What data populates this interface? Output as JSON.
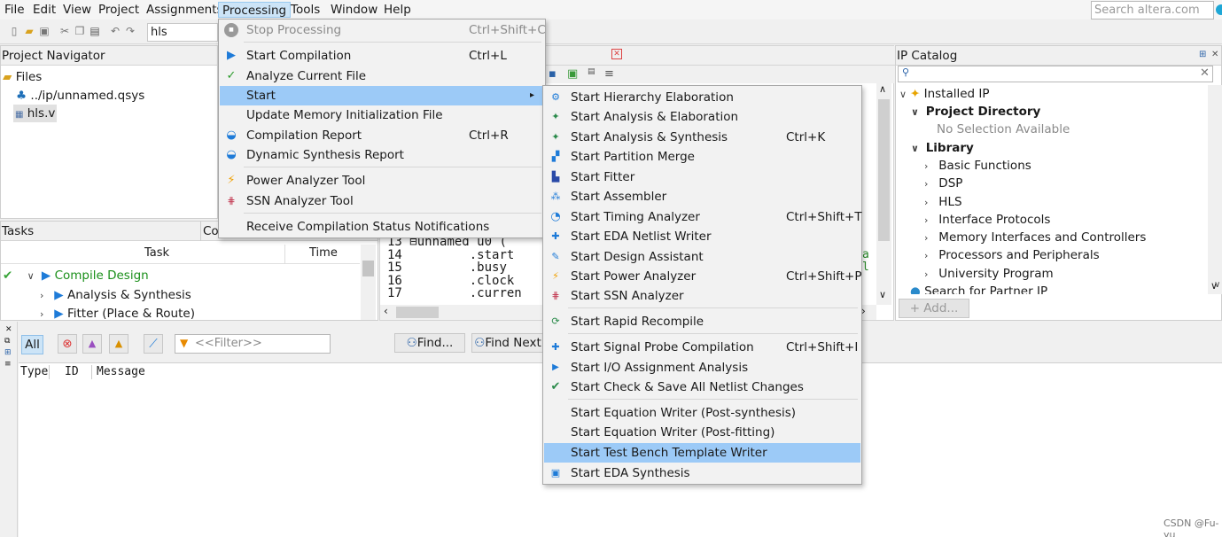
{
  "menubar": {
    "items": [
      "File",
      "Edit",
      "View",
      "Project",
      "Assignments",
      "Processing",
      "Tools",
      "Window",
      "Help"
    ],
    "search_placeholder": "Search altera.com"
  },
  "toolbar": {
    "entity": "hls"
  },
  "project_navigator": {
    "title": "Project Navigator",
    "root": "Files",
    "files": [
      "../ip/unnamed.qsys",
      "hls.v"
    ]
  },
  "tasks": {
    "title": "Tasks",
    "tab2": "Co",
    "col_task": "Task",
    "col_time": "Time",
    "rows": [
      "Compile Design",
      "Analysis & Synthesis",
      "Fitter (Place & Route)"
    ]
  },
  "editor": {
    "line_numbers": [
      "13",
      "14",
      "15",
      "16",
      "17"
    ],
    "lines": [
      "⊟unnamed u0 (",
      "        .start",
      "        .busy",
      "        .clock",
      "        .curren"
    ],
    "margin_chars": [
      "a",
      "l"
    ]
  },
  "ip_catalog": {
    "title": "IP Catalog",
    "installed": "Installed IP",
    "project_directory": "Project Directory",
    "no_selection": "No Selection Available",
    "library": "Library",
    "library_items": [
      "Basic Functions",
      "DSP",
      "HLS",
      "Interface Protocols",
      "Memory Interfaces and Controllers",
      "Processors and Peripherals",
      "University Program"
    ],
    "partner": "Search for Partner IP",
    "add_label": "+ Add..."
  },
  "messages": {
    "all_label": "All",
    "filter_placeholder": "<<Filter>>",
    "find_label": "Find...",
    "find_next_label": "Find Next",
    "col_type": "Type",
    "col_id": "ID",
    "col_message": "Message"
  },
  "processing_menu": {
    "items": [
      {
        "label": "Stop Processing",
        "shortcut": "Ctrl+Shift+C",
        "icon": "stop-icon"
      },
      {
        "label": "Start Compilation",
        "shortcut": "Ctrl+L",
        "icon": "play-icon"
      },
      {
        "label": "Analyze Current File",
        "shortcut": "",
        "icon": "analyze-icon"
      },
      {
        "label": "Start",
        "shortcut": "",
        "icon": ""
      },
      {
        "label": "Update Memory Initialization File",
        "shortcut": "",
        "icon": ""
      },
      {
        "label": "Compilation Report",
        "shortcut": "Ctrl+R",
        "icon": "report-icon"
      },
      {
        "label": "Dynamic Synthesis Report",
        "shortcut": "",
        "icon": "report-icon"
      },
      {
        "label": "Power Analyzer Tool",
        "shortcut": "",
        "icon": "power-icon"
      },
      {
        "label": "SSN Analyzer Tool",
        "shortcut": "",
        "icon": "ssn-icon"
      },
      {
        "label": "Receive Compilation Status Notifications",
        "shortcut": "",
        "icon": ""
      }
    ]
  },
  "start_submenu": {
    "items": [
      {
        "label": "Start Hierarchy Elaboration",
        "shortcut": ""
      },
      {
        "label": "Start Analysis & Elaboration",
        "shortcut": ""
      },
      {
        "label": "Start Analysis & Synthesis",
        "shortcut": "Ctrl+K"
      },
      {
        "label": "Start Partition Merge",
        "shortcut": ""
      },
      {
        "label": "Start Fitter",
        "shortcut": ""
      },
      {
        "label": "Start Assembler",
        "shortcut": ""
      },
      {
        "label": "Start Timing Analyzer",
        "shortcut": "Ctrl+Shift+T"
      },
      {
        "label": "Start EDA Netlist Writer",
        "shortcut": ""
      },
      {
        "label": "Start Design Assistant",
        "shortcut": ""
      },
      {
        "label": "Start Power Analyzer",
        "shortcut": "Ctrl+Shift+P"
      },
      {
        "label": "Start SSN Analyzer",
        "shortcut": ""
      },
      {
        "label": "Start Rapid Recompile",
        "shortcut": ""
      },
      {
        "label": "Start Signal Probe Compilation",
        "shortcut": "Ctrl+Shift+I"
      },
      {
        "label": "Start I/O Assignment Analysis",
        "shortcut": ""
      },
      {
        "label": "Start Check & Save All Netlist Changes",
        "shortcut": ""
      },
      {
        "label": "Start Equation Writer (Post-synthesis)",
        "shortcut": ""
      },
      {
        "label": "Start Equation Writer (Post-fitting)",
        "shortcut": ""
      },
      {
        "label": "Start Test Bench Template Writer",
        "shortcut": ""
      },
      {
        "label": "Start EDA Synthesis",
        "shortcut": ""
      }
    ]
  },
  "watermark": "CSDN @Fu-yu",
  "colors": {
    "highlight": "#9ccaf7",
    "compile_green": "#1a8f1a",
    "play_blue": "#1e7bd8"
  }
}
